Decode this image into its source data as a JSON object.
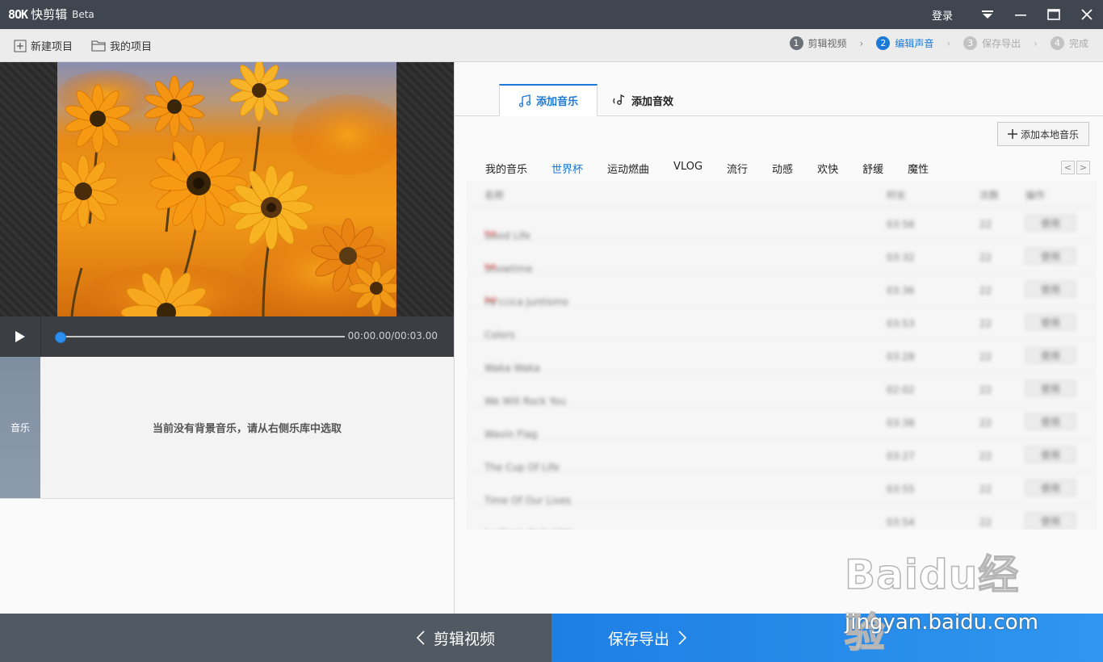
{
  "titlebar": {
    "logo_mark": "8OK",
    "app_name": "快剪辑",
    "beta": "Beta",
    "login": "登录"
  },
  "toolbar": {
    "new_project": "新建项目",
    "my_projects": "我的项目"
  },
  "steps": [
    {
      "num": "1",
      "label": "剪辑视频"
    },
    {
      "num": "2",
      "label": "编辑声音"
    },
    {
      "num": "3",
      "label": "保存导出"
    },
    {
      "num": "4",
      "label": "完成"
    }
  ],
  "player": {
    "timecode": "00:00.00/00:03.00",
    "progress": 0.0
  },
  "music_panel": {
    "tab_label": "音乐",
    "empty_message": "当前没有背景音乐，请从右侧乐库中选取"
  },
  "right_panel": {
    "tab_add_music": "添加音乐",
    "tab_add_effect": "添加音效",
    "add_local_music": "添加本地音乐",
    "categories": [
      "我的音乐",
      "世界杯",
      "运动燃曲",
      "VLOG",
      "流行",
      "动感",
      "欢快",
      "舒缓",
      "魔性"
    ],
    "active_category": "世界杯",
    "nav_prev": "<",
    "nav_next": ">",
    "list_header": {
      "name": "名称",
      "duration": "时长",
      "count": "次数",
      "op": "操作"
    },
    "list_rows": [
      {
        "name": "Good Life",
        "duration": "03:56",
        "count": "22",
        "op": "使用",
        "hot": "hot"
      },
      {
        "name": "Showtime",
        "duration": "03:32",
        "count": "22",
        "op": "使用",
        "hot": "hot"
      },
      {
        "name": "Pa'ccica Juntismo",
        "duration": "03:36",
        "count": "22",
        "op": "使用",
        "hot": "hot"
      },
      {
        "name": "Colors",
        "duration": "03:53",
        "count": "22",
        "op": "使用",
        "hot": ""
      },
      {
        "name": "Waka Waka",
        "duration": "03:28",
        "count": "22",
        "op": "使用",
        "hot": ""
      },
      {
        "name": "We Will Rock You",
        "duration": "02:02",
        "count": "22",
        "op": "使用",
        "hot": ""
      },
      {
        "name": "Wavin Flag",
        "duration": "03:38",
        "count": "22",
        "op": "使用",
        "hot": ""
      },
      {
        "name": "The Cup Of Life",
        "duration": "03:27",
        "count": "22",
        "op": "使用",
        "hot": ""
      },
      {
        "name": "Time Of Our Lives",
        "duration": "03:55",
        "count": "22",
        "op": "使用",
        "hot": ""
      },
      {
        "name": "La Copa de la Vida",
        "duration": "03:54",
        "count": "22",
        "op": "使用",
        "hot": ""
      }
    ]
  },
  "bottom": {
    "back_label": "剪辑视频",
    "next_label": "保存导出"
  },
  "watermark": {
    "logo": "Baidu经验",
    "url": "jingyan.baidu.com"
  },
  "colors": {
    "accent": "#1b7ad8",
    "titlebar": "#3f4650",
    "bottom_left": "#515962"
  }
}
